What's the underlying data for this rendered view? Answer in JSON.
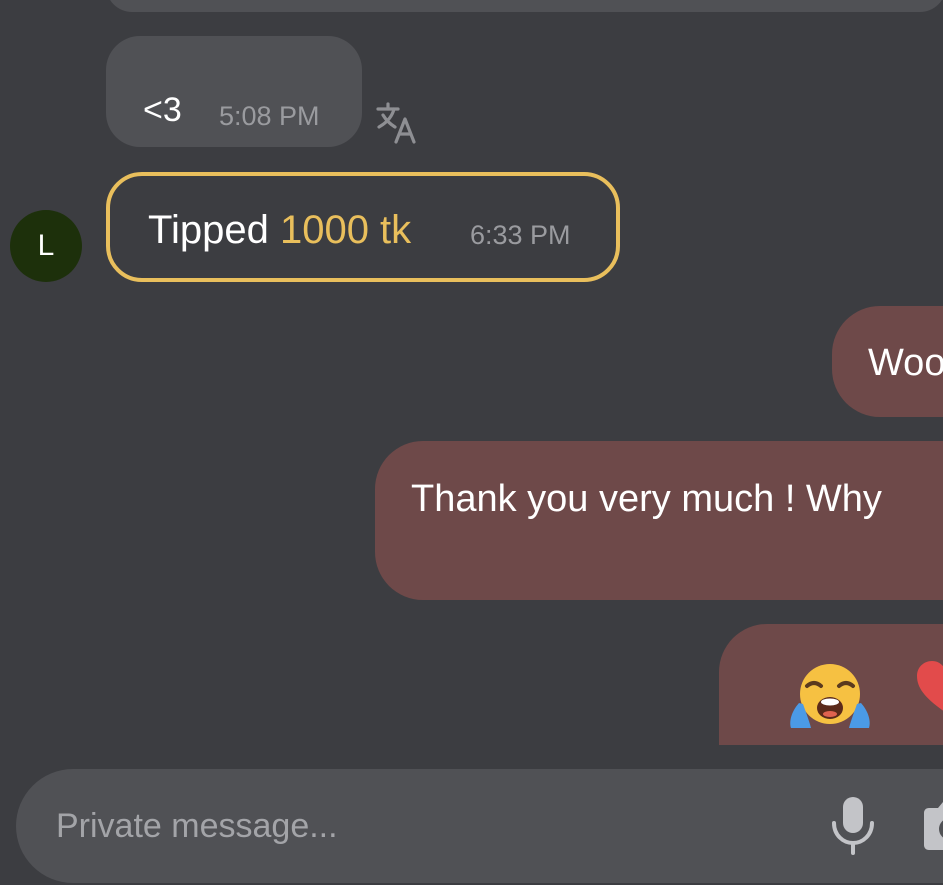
{
  "conversation": {
    "messages": [
      {
        "kind": "received",
        "text": "<3",
        "time": "5:08 PM"
      },
      {
        "kind": "tip",
        "label": "Tipped",
        "amount": "1000 tk",
        "time": "6:33 PM",
        "avatar_letter": "L"
      },
      {
        "kind": "sent",
        "text": "Woo"
      },
      {
        "kind": "sent",
        "text": "Thank you very much ! Why"
      },
      {
        "kind": "sent",
        "emojis": [
          "crying-face",
          "red-heart"
        ]
      }
    ]
  },
  "composer": {
    "placeholder": "Private message...",
    "value": ""
  },
  "icons": {
    "translate": "translate-icon",
    "mic": "microphone-icon",
    "camera": "camera-icon"
  },
  "colors": {
    "background": "#3c3d41",
    "received_bubble": "#505155",
    "sent_bubble": "#6e4949",
    "tip_accent": "#e9bf5c",
    "avatar": "#1d300b",
    "timestamp": "#9a9b9f"
  }
}
